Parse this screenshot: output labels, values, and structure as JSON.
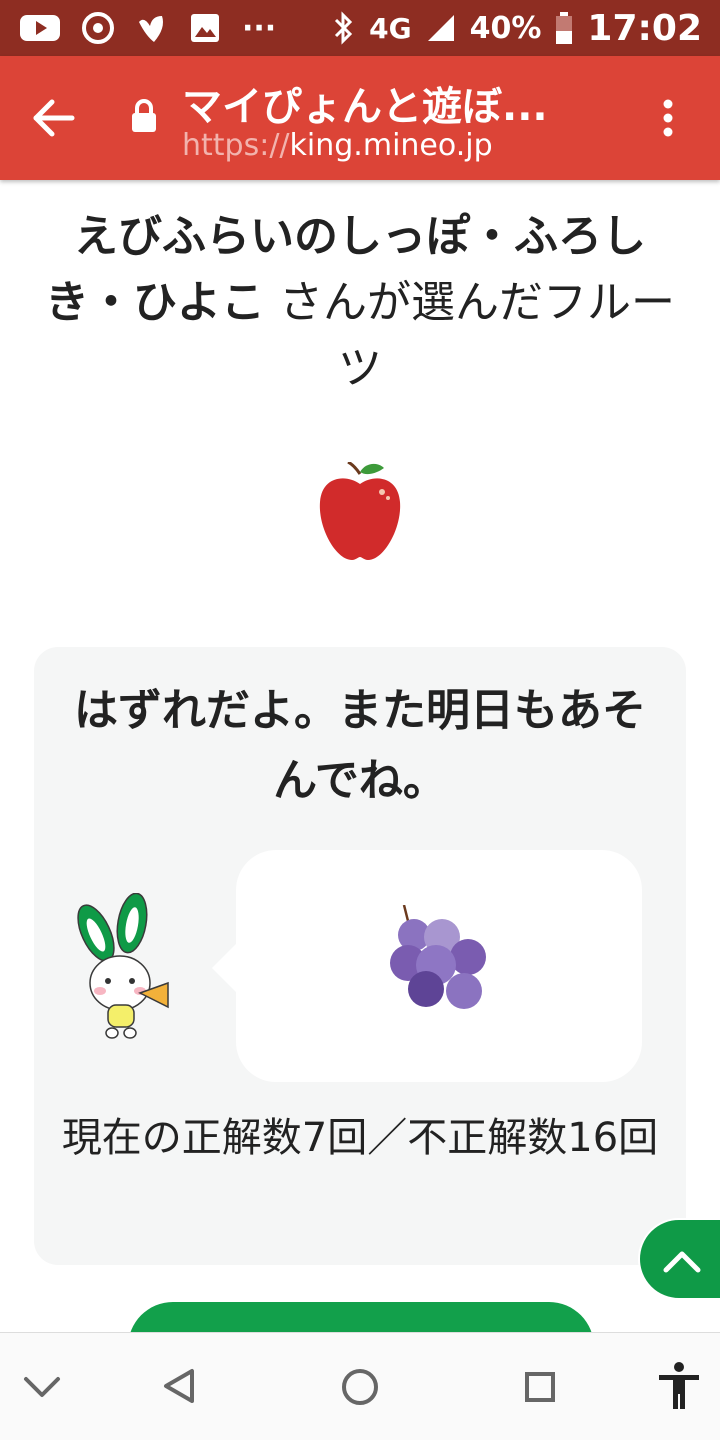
{
  "status_bar": {
    "icons": [
      "youtube-icon",
      "chrome-icon",
      "app-icon",
      "image-icon",
      "more-dots-icon",
      "bluetooth-icon",
      "signal-icon",
      "battery-icon"
    ],
    "network": "4G",
    "battery": "40%",
    "time": "17:02"
  },
  "browser": {
    "title": "マイぴょんと遊ぼ...",
    "url_scheme": "https://",
    "url_host": "king.mineo.jp",
    "color": "#dc4437"
  },
  "heading": {
    "name": "えびふらいのしっぽ・ふろしき・ひよこ",
    "suffix": " さんが選んだフルーツ"
  },
  "result": {
    "message": "はずれだよ。また明日もあそんでね。",
    "score": "現在の正解数7回／不正解数16回"
  },
  "colors": {
    "accent_green": "#0f9a47",
    "card_bg": "#f5f6f6"
  },
  "nav_bar": {
    "icons": [
      "chevron-down-icon",
      "back-triangle-icon",
      "home-circle-icon",
      "recents-square-icon",
      "accessibility-icon"
    ]
  }
}
